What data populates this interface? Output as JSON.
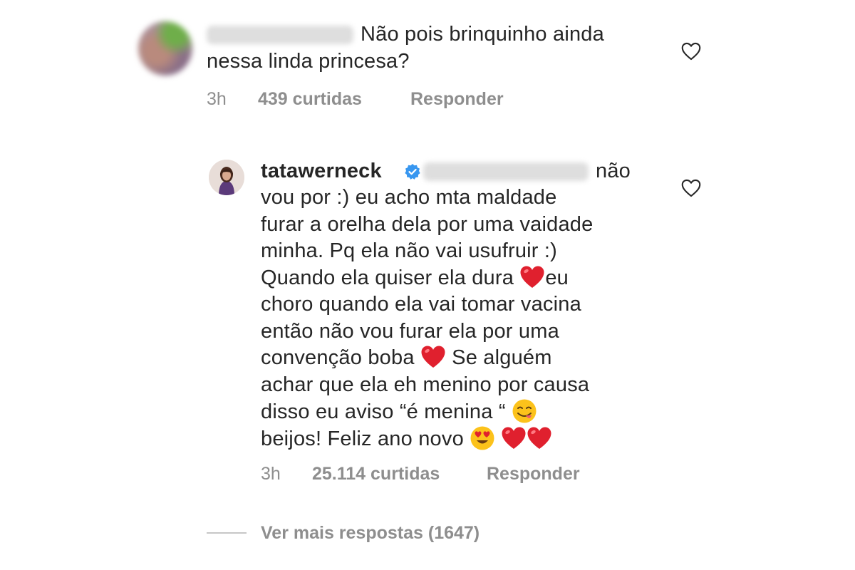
{
  "comments": [
    {
      "text_line1": "Não pois brinquinho ainda",
      "text_line2": "nessa linda princesa?",
      "time": "3h",
      "likes": "439 curtidas",
      "reply": "Responder"
    },
    {
      "username": "tatawerneck",
      "first_line_tail": "não",
      "body": {
        "l1": "vou por :) eu acho mta maldade",
        "l2": "furar a orelha dela por uma vaidade",
        "l3": "minha. Pq ela não vai usufruir :)",
        "l4a": "Quando ela quiser ela dura ",
        "l4b": "eu",
        "l5": "choro quando ela vai tomar vacina",
        "l6": "então não vou furar ela por uma",
        "l7a": "convenção boba ",
        "l7b": " Se alguém",
        "l8": "achar que ela eh menino por causa",
        "l9": "disso eu aviso “é menina “ ",
        "l10": "beijos! Feliz ano novo "
      },
      "time": "3h",
      "likes": "25.114 curtidas",
      "reply": "Responder"
    }
  ],
  "view_more": "Ver mais respostas (1647)",
  "icons": {
    "like": "heart-outline-icon",
    "verified": "verified-badge-icon",
    "emoji_heart": "red-heart-emoji",
    "emoji_yum": "face-savoring-food-emoji",
    "emoji_love": "heart-eyes-emoji"
  },
  "colors": {
    "text": "#262626",
    "meta": "#8e8e8e",
    "verified": "#3897f0",
    "heart": "#e0202e"
  }
}
